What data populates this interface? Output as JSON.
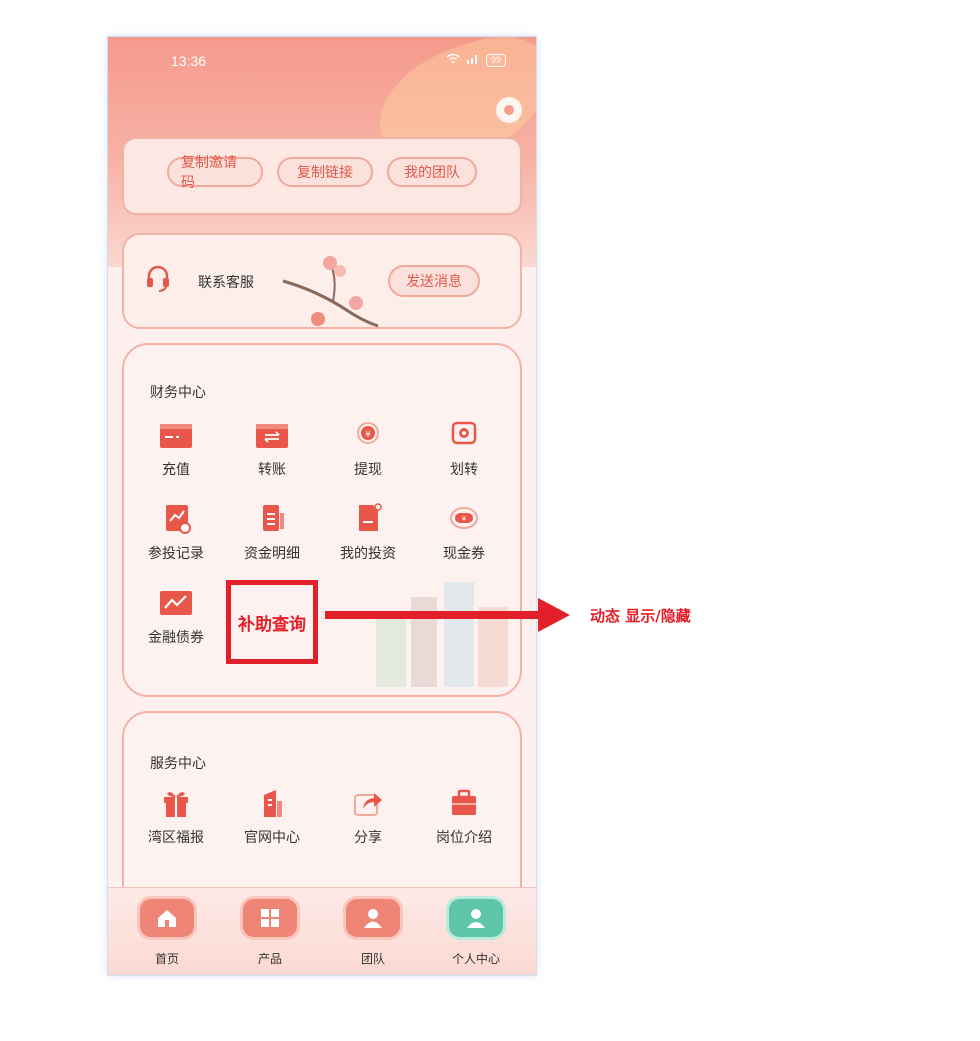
{
  "status_bar": {
    "time": "13:36",
    "battery": "99"
  },
  "invite": {
    "buttons": [
      "复制邀请码",
      "复制链接",
      "我的团队"
    ]
  },
  "contact": {
    "label": "联系客服",
    "button": "发送消息"
  },
  "finance": {
    "title": "财务中心",
    "items": [
      {
        "label": "充值",
        "icon": "recharge-card-icon"
      },
      {
        "label": "转账",
        "icon": "transfer-card-icon"
      },
      {
        "label": "提现",
        "icon": "withdraw-yuan-icon"
      },
      {
        "label": "划转",
        "icon": "swap-icon"
      },
      {
        "label": "参投记录",
        "icon": "record-chart-icon"
      },
      {
        "label": "资金明细",
        "icon": "fund-detail-icon"
      },
      {
        "label": "我的投资",
        "icon": "investment-doc-icon"
      },
      {
        "label": "现金券",
        "icon": "cash-coupon-icon"
      },
      {
        "label": "金融债券",
        "icon": "bond-chart-icon"
      }
    ]
  },
  "service": {
    "title": "服务中心",
    "items": [
      {
        "label": "湾区福报",
        "icon": "gift-icon"
      },
      {
        "label": "官网中心",
        "icon": "building-icon"
      },
      {
        "label": "分享",
        "icon": "share-icon"
      },
      {
        "label": "岗位介绍",
        "icon": "briefcase-icon"
      }
    ]
  },
  "tabbar": [
    {
      "label": "首页",
      "icon": "home-icon"
    },
    {
      "label": "产品",
      "icon": "grid-icon"
    },
    {
      "label": "团队",
      "icon": "team-icon"
    },
    {
      "label": "个人中心",
      "icon": "user-icon"
    }
  ],
  "annotation": {
    "box_label": "补助查询",
    "note": "动态 显示/隐藏"
  },
  "colors": {
    "accent": "#e2584a",
    "annotation": "#e3202a",
    "active_tab": "#5fc5a8"
  }
}
